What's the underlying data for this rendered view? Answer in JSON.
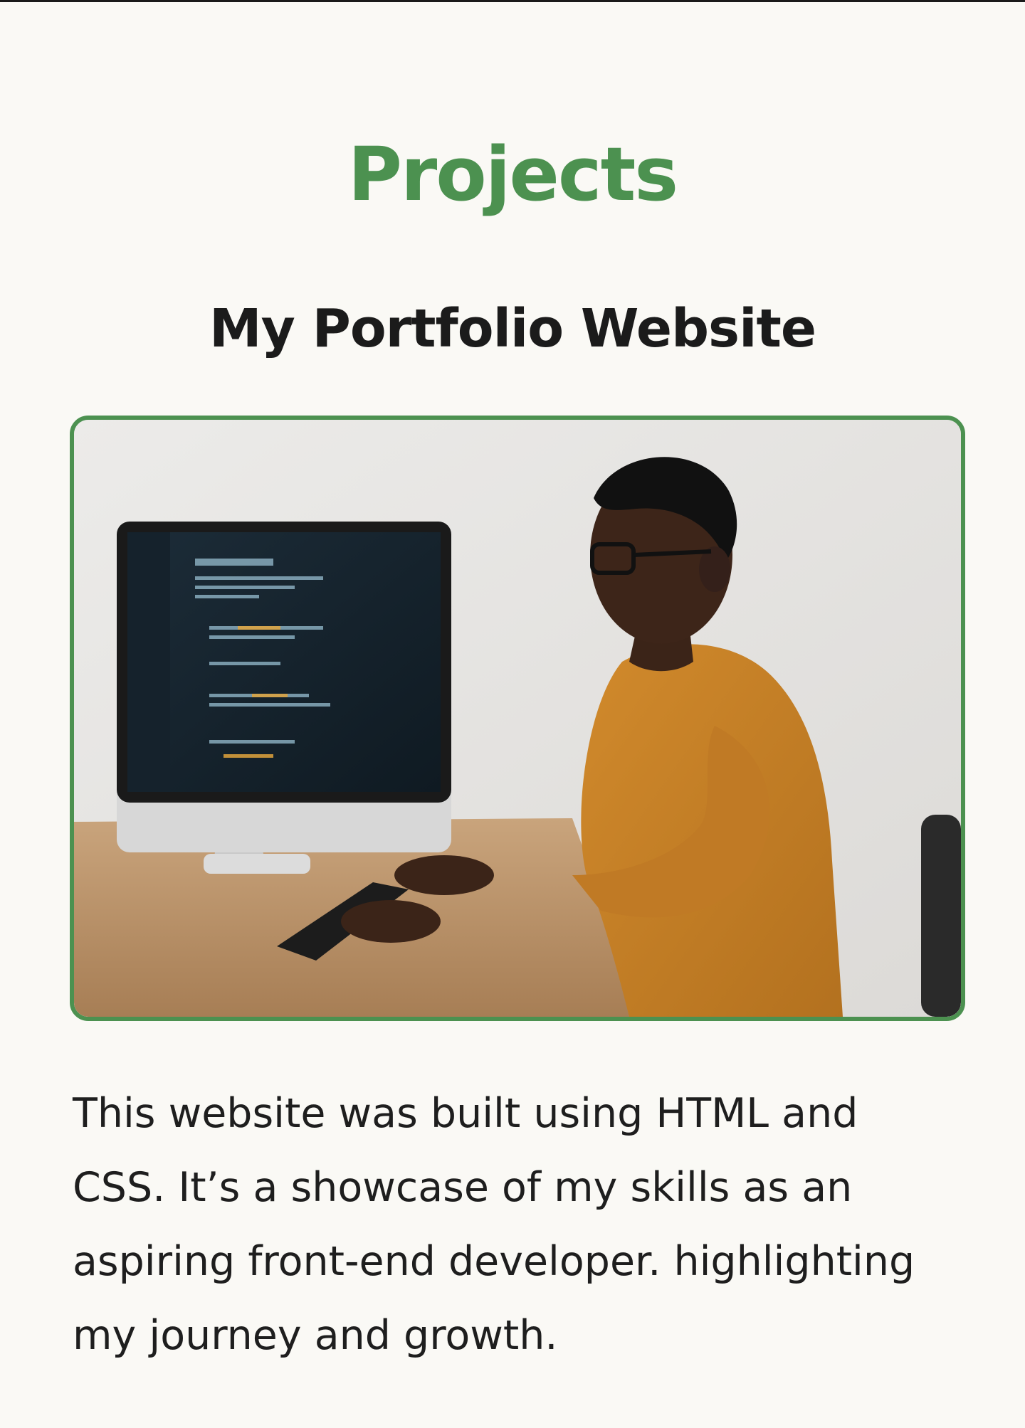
{
  "colors": {
    "accent": "#4c9150",
    "background": "#faf9f5",
    "text": "#1b1b1b"
  },
  "section": {
    "title": "Projects"
  },
  "project": {
    "title": "My Portfolio Website",
    "image_alt": "Developer in an orange sweater typing code on a desktop computer",
    "description": "This website was built using HTML and CSS. It’s a showcase of my skills as an aspiring front-end developer. highlighting my journey and growth."
  }
}
